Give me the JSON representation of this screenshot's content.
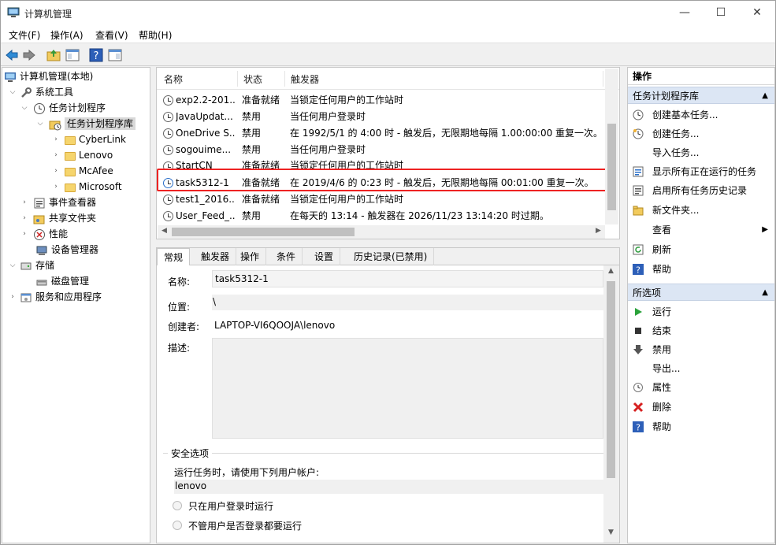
{
  "window": {
    "title": "计算机管理",
    "minimize": "—",
    "maximize": "☐",
    "close": "✕"
  },
  "menu": [
    "文件(F)",
    "操作(A)",
    "查看(V)",
    "帮助(H)"
  ],
  "tree": [
    {
      "label": "计算机管理(本地)",
      "icon": "computer-icon"
    },
    {
      "label": "系统工具",
      "icon": "tools-icon"
    },
    {
      "label": "任务计划程序",
      "icon": "clock-icon"
    },
    {
      "label": "任务计划程序库",
      "icon": "folder-clock-icon"
    },
    {
      "label": "CyberLink",
      "icon": "folder-icon"
    },
    {
      "label": "Lenovo",
      "icon": "folder-icon"
    },
    {
      "label": "McAfee",
      "icon": "folder-icon"
    },
    {
      "label": "Microsoft",
      "icon": "folder-icon"
    },
    {
      "label": "事件查看器",
      "icon": "event-icon"
    },
    {
      "label": "共享文件夹",
      "icon": "share-icon"
    },
    {
      "label": "性能",
      "icon": "perf-icon"
    },
    {
      "label": "设备管理器",
      "icon": "device-icon"
    },
    {
      "label": "存储",
      "icon": "storage-icon"
    },
    {
      "label": "磁盘管理",
      "icon": "disk-icon"
    },
    {
      "label": "服务和应用程序",
      "icon": "services-icon"
    }
  ],
  "list": {
    "columns": [
      "名称",
      "状态",
      "触发器"
    ],
    "rows": [
      {
        "name": "exp2.2-201...",
        "status": "准备就绪",
        "trigger": "当锁定任何用户的工作站时"
      },
      {
        "name": "JavaUpdat...",
        "status": "禁用",
        "trigger": "当任何用户登录时"
      },
      {
        "name": "OneDrive S...",
        "status": "禁用",
        "trigger": "在 1992/5/1 的 4:00 时 - 触发后，无限期地每隔 1.00:00:00 重复一次。"
      },
      {
        "name": "sogouime...",
        "status": "禁用",
        "trigger": "当任何用户登录时"
      },
      {
        "name": "StartCN",
        "status": "准备就绪",
        "trigger": "当锁定任何用户的工作站时"
      },
      {
        "name": "task5312-1",
        "status": "准备就绪",
        "trigger": "在 2019/4/6 的 0:23 时 - 触发后，无限期地每隔 00:01:00 重复一次。"
      },
      {
        "name": "test1_2016...",
        "status": "准备就绪",
        "trigger": "当锁定任何用户的工作站时"
      },
      {
        "name": "User_Feed_...",
        "status": "禁用",
        "trigger": "在每天的 13:14 - 触发器在 2026/11/23 13:14:20 时过期。"
      }
    ]
  },
  "tabs": [
    "常规",
    "触发器",
    "操作",
    "条件",
    "设置",
    "历史记录(已禁用)"
  ],
  "general": {
    "name_label": "名称:",
    "name_value": "task5312-1",
    "location_label": "位置:",
    "location_value": "\\",
    "author_label": "创建者:",
    "author_value": "LAPTOP-VI6QOOJA\\lenovo",
    "desc_label": "描述:",
    "security_title": "安全选项",
    "run_as_label": "运行任务时，请使用下列用户帐户:",
    "run_as_user": "lenovo",
    "radio1": "只在用户登录时运行",
    "radio2": "不管用户是否登录都要运行"
  },
  "actions": {
    "header": "操作",
    "section1": "任务计划程序库",
    "items1": [
      {
        "label": "创建基本任务...",
        "icon": "create-basic-task-icon"
      },
      {
        "label": "创建任务...",
        "icon": "create-task-icon"
      },
      {
        "label": "导入任务...",
        "icon": ""
      },
      {
        "label": "显示所有正在运行的任务",
        "icon": "running-tasks-icon"
      },
      {
        "label": "启用所有任务历史记录",
        "icon": "history-icon"
      },
      {
        "label": "新文件夹...",
        "icon": "new-folder-icon"
      },
      {
        "label": "查看",
        "icon": ""
      },
      {
        "label": "刷新",
        "icon": "refresh-icon"
      },
      {
        "label": "帮助",
        "icon": "help-icon"
      }
    ],
    "section2": "所选项",
    "items2": [
      {
        "label": "运行",
        "icon": "run-icon"
      },
      {
        "label": "结束",
        "icon": "stop-icon"
      },
      {
        "label": "禁用",
        "icon": "disable-icon"
      },
      {
        "label": "导出...",
        "icon": ""
      },
      {
        "label": "属性",
        "icon": "properties-icon"
      },
      {
        "label": "删除",
        "icon": "delete-icon"
      },
      {
        "label": "帮助",
        "icon": "help-icon"
      }
    ]
  },
  "colors": {
    "accent": "#2a6fc9",
    "selection_border": "#e22222",
    "section_bg": "#dce6f4"
  }
}
